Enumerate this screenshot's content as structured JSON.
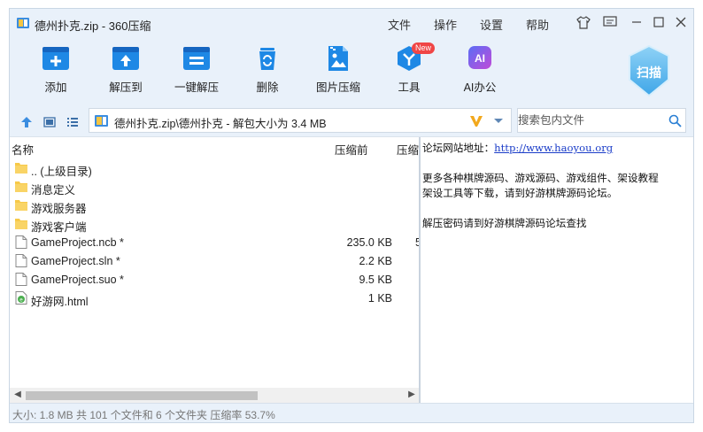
{
  "window": {
    "title": "德州扑克.zip - 360压缩",
    "menu": [
      "文件",
      "操作",
      "设置",
      "帮助"
    ]
  },
  "toolbar": {
    "tools": [
      {
        "label": "添加",
        "icon": "add-icon"
      },
      {
        "label": "解压到",
        "icon": "extract-to-icon"
      },
      {
        "label": "一键解压",
        "icon": "one-click-extract-icon"
      },
      {
        "label": "删除",
        "icon": "trash-icon"
      },
      {
        "label": "图片压缩",
        "icon": "image-compress-icon"
      },
      {
        "label": "工具",
        "icon": "tools-icon"
      },
      {
        "label": "AI办公",
        "icon": "ai-icon"
      }
    ],
    "new_badge": "New",
    "ai_icon_text": "AI",
    "scan_label": "扫描"
  },
  "address": {
    "path": "德州扑克.zip\\德州扑克 - 解包大小为 3.4 MB",
    "search_placeholder": "搜索包内文件"
  },
  "file_list": {
    "columns": {
      "name": "名称",
      "compressed": "压缩前",
      "ratio": "压缩"
    },
    "rows": [
      {
        "name": ".. (上级目录)",
        "type": "folder",
        "size": "",
        "extra": ""
      },
      {
        "name": "消息定义",
        "type": "folder",
        "size": "",
        "extra": ""
      },
      {
        "name": "游戏服务器",
        "type": "folder",
        "size": "",
        "extra": ""
      },
      {
        "name": "游戏客户端",
        "type": "folder",
        "size": "",
        "extra": ""
      },
      {
        "name": "GameProject.ncb *",
        "type": "file",
        "size": "235.0 KB",
        "extra": "5"
      },
      {
        "name": "GameProject.sln *",
        "type": "file",
        "size": "2.2 KB",
        "extra": ""
      },
      {
        "name": "GameProject.suo *",
        "type": "file",
        "size": "9.5 KB",
        "extra": ""
      },
      {
        "name": "好游网.html",
        "type": "html",
        "size": "1 KB",
        "extra": ""
      }
    ]
  },
  "comment": {
    "line1_prefix": "论坛网站地址：",
    "line1_link": "http://www.haoyou.org",
    "line2": "更多各种棋牌源码、游戏源码、游戏组件、架设教程",
    "line3": "架设工具等下载，请到好游棋牌源码论坛。",
    "line4": "解压密码请到好游棋牌源码论坛查找"
  },
  "status": {
    "text": "大小: 1.8 MB 共 101 个文件和 6 个文件夹 压缩率 53.7%"
  },
  "colors": {
    "chrome_bg": "#e9f1fa",
    "accent_blue": "#1e88e5",
    "folder_yellow": "#f7c948",
    "link_blue": "#1a3cc8"
  }
}
